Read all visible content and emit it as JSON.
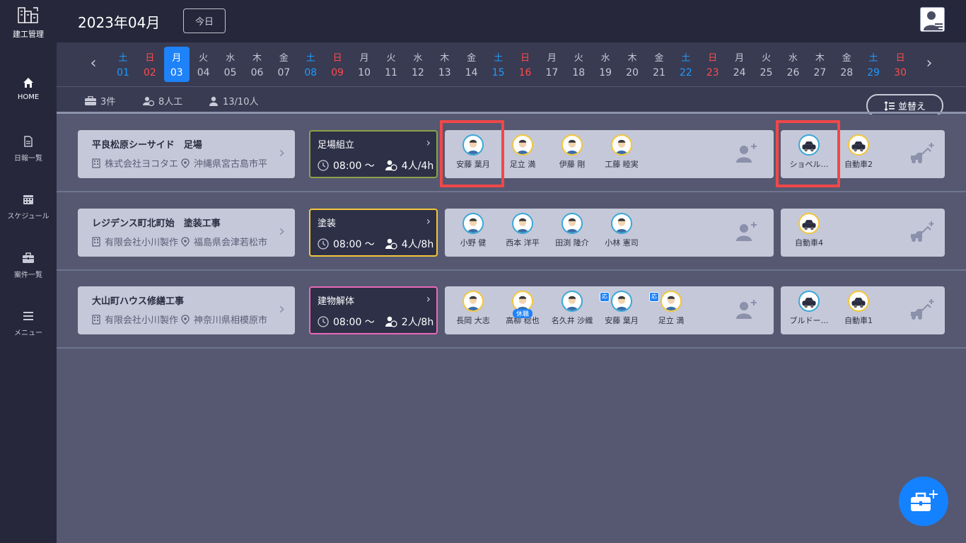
{
  "app": {
    "logo_text": "建工管理"
  },
  "header": {
    "month": "2023年04月",
    "today_label": "今日"
  },
  "sidebar": {
    "items": [
      {
        "label": "HOME",
        "icon": "home-icon",
        "active": true
      },
      {
        "label": "日報一覧",
        "icon": "document-icon"
      },
      {
        "label": "スケジュール",
        "icon": "calendar-icon"
      },
      {
        "label": "案件一覧",
        "icon": "briefcase-icon"
      },
      {
        "label": "メニュー",
        "icon": "menu-icon"
      }
    ]
  },
  "calendar": {
    "days": [
      {
        "w": "土",
        "n": "01",
        "type": "sat"
      },
      {
        "w": "日",
        "n": "02",
        "type": "sun"
      },
      {
        "w": "月",
        "n": "03",
        "type": "sel"
      },
      {
        "w": "火",
        "n": "04"
      },
      {
        "w": "水",
        "n": "05"
      },
      {
        "w": "木",
        "n": "06"
      },
      {
        "w": "金",
        "n": "07"
      },
      {
        "w": "土",
        "n": "08",
        "type": "sat"
      },
      {
        "w": "日",
        "n": "09",
        "type": "sun"
      },
      {
        "w": "月",
        "n": "10"
      },
      {
        "w": "火",
        "n": "11"
      },
      {
        "w": "水",
        "n": "12"
      },
      {
        "w": "木",
        "n": "13"
      },
      {
        "w": "金",
        "n": "14"
      },
      {
        "w": "土",
        "n": "15",
        "type": "sat"
      },
      {
        "w": "日",
        "n": "16",
        "type": "sun"
      },
      {
        "w": "月",
        "n": "17"
      },
      {
        "w": "火",
        "n": "18"
      },
      {
        "w": "水",
        "n": "19"
      },
      {
        "w": "木",
        "n": "20"
      },
      {
        "w": "金",
        "n": "21"
      },
      {
        "w": "土",
        "n": "22",
        "type": "sat"
      },
      {
        "w": "日",
        "n": "23",
        "type": "sun"
      },
      {
        "w": "月",
        "n": "24"
      },
      {
        "w": "火",
        "n": "25"
      },
      {
        "w": "水",
        "n": "26"
      },
      {
        "w": "木",
        "n": "27"
      },
      {
        "w": "金",
        "n": "28"
      },
      {
        "w": "土",
        "n": "29",
        "type": "sat"
      },
      {
        "w": "日",
        "n": "30",
        "type": "sun"
      }
    ]
  },
  "summary": {
    "projects": "3件",
    "workers": "8人工",
    "people": "13/10人",
    "sort_label": "並替え"
  },
  "rows": [
    {
      "project": {
        "title": "平良松原シーサイド　足場",
        "company": "株式会社ヨコタエ",
        "address": "沖縄県宮古島市平"
      },
      "task": {
        "name": "足場組立",
        "time": "08:00 ～",
        "workload": "4人/4h",
        "color": "#8aa34a"
      },
      "workers": [
        {
          "name": "安藤 葉月",
          "ring": "blue"
        },
        {
          "name": "足立 満",
          "ring": "yel"
        },
        {
          "name": "伊藤 剛",
          "ring": "yel"
        },
        {
          "name": "工藤 睦実",
          "ring": "yel"
        }
      ],
      "equipment": [
        {
          "name": "ショベル…",
          "ring": "blue"
        },
        {
          "name": "自動車2",
          "ring": "yel"
        }
      ]
    },
    {
      "project": {
        "title": "レジデンス町北町始　塗装工事",
        "company": "有限会社小川製作",
        "address": "福島県会津若松市"
      },
      "task": {
        "name": "塗装",
        "time": "08:00 ～",
        "workload": "4人/8h",
        "color": "#f2c73c"
      },
      "workers": [
        {
          "name": "小野 健",
          "ring": "blue"
        },
        {
          "name": "西本 洋平",
          "ring": "blue"
        },
        {
          "name": "田渕 隆介",
          "ring": "blue"
        },
        {
          "name": "小林 憲司",
          "ring": "blue"
        }
      ],
      "equipment": [
        {
          "name": "自動車4",
          "ring": "yel"
        }
      ]
    },
    {
      "project": {
        "title": "大山町ハウス修繕工事",
        "company": "有限会社小川製作",
        "address": "神奈川県相模原市"
      },
      "task": {
        "name": "建物解体",
        "time": "08:00 ～",
        "workload": "2人/8h",
        "color": "#e86ab8"
      },
      "workers": [
        {
          "name": "長岡 大志",
          "ring": "yel"
        },
        {
          "name": "高柳 稔也",
          "ring": "yel",
          "badge": "休職"
        },
        {
          "name": "名久井 沙織",
          "ring": "blue"
        },
        {
          "name": "安藤 葉月",
          "ring": "blue",
          "tag": "応"
        },
        {
          "name": "足立 満",
          "ring": "yel",
          "tag": "応"
        }
      ],
      "equipment": [
        {
          "name": "ブルドー…",
          "ring": "blue"
        },
        {
          "name": "自動車1",
          "ring": "yel"
        }
      ]
    }
  ],
  "colors": {
    "accent": "#1e82f8",
    "saturday": "#1e9bff",
    "sunday": "#ff4b4b",
    "highlight": "#f04848"
  }
}
